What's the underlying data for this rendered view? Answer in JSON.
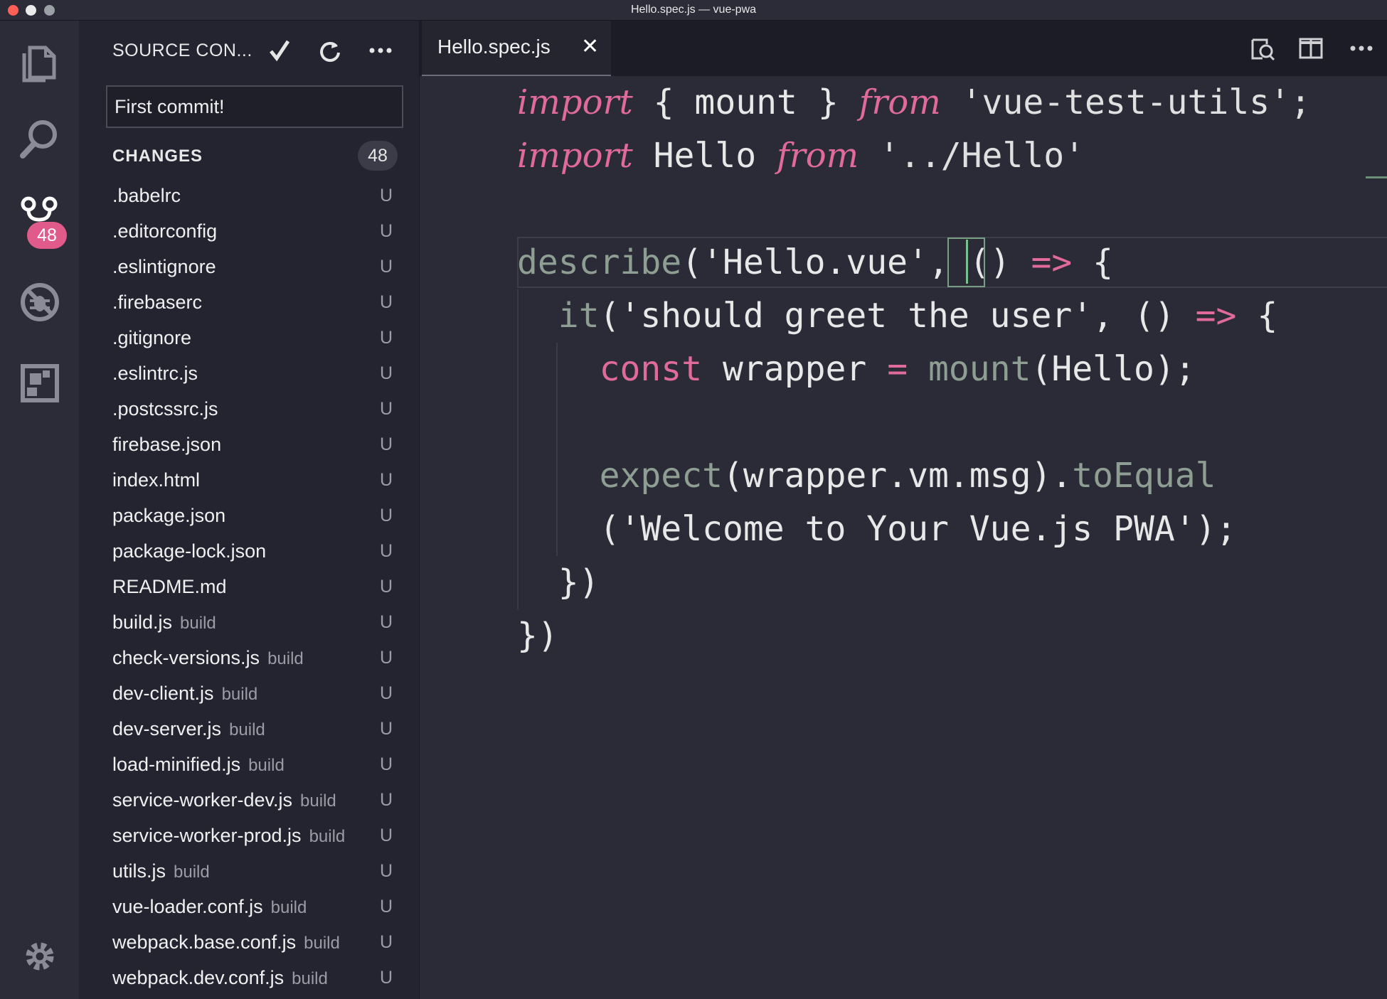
{
  "window": {
    "title": "Hello.spec.js — vue-pwa"
  },
  "activity_bar": {
    "items": [
      {
        "name": "files-icon"
      },
      {
        "name": "search-icon"
      },
      {
        "name": "source-control-icon",
        "badge": "48"
      },
      {
        "name": "debug-icon"
      },
      {
        "name": "extensions-icon"
      }
    ],
    "settings": "gear-icon"
  },
  "sidebar": {
    "header": "SOURCE CON...",
    "actions": [
      "commit-check-icon",
      "refresh-icon",
      "more-icon"
    ],
    "commit_message": "First commit!",
    "changes_label": "CHANGES",
    "changes_count": "48",
    "files": [
      {
        "name": ".babelrc",
        "dir": "",
        "status": "U"
      },
      {
        "name": ".editorconfig",
        "dir": "",
        "status": "U"
      },
      {
        "name": ".eslintignore",
        "dir": "",
        "status": "U"
      },
      {
        "name": ".firebaserc",
        "dir": "",
        "status": "U"
      },
      {
        "name": ".gitignore",
        "dir": "",
        "status": "U"
      },
      {
        "name": ".eslintrc.js",
        "dir": "",
        "status": "U"
      },
      {
        "name": ".postcssrc.js",
        "dir": "",
        "status": "U"
      },
      {
        "name": "firebase.json",
        "dir": "",
        "status": "U"
      },
      {
        "name": "index.html",
        "dir": "",
        "status": "U"
      },
      {
        "name": "package.json",
        "dir": "",
        "status": "U"
      },
      {
        "name": "package-lock.json",
        "dir": "",
        "status": "U"
      },
      {
        "name": "README.md",
        "dir": "",
        "status": "U"
      },
      {
        "name": "build.js",
        "dir": "build",
        "status": "U"
      },
      {
        "name": "check-versions.js",
        "dir": "build",
        "status": "U"
      },
      {
        "name": "dev-client.js",
        "dir": "build",
        "status": "U"
      },
      {
        "name": "dev-server.js",
        "dir": "build",
        "status": "U"
      },
      {
        "name": "load-minified.js",
        "dir": "build",
        "status": "U"
      },
      {
        "name": "service-worker-dev.js",
        "dir": "build",
        "status": "U"
      },
      {
        "name": "service-worker-prod.js",
        "dir": "build",
        "status": "U"
      },
      {
        "name": "utils.js",
        "dir": "build",
        "status": "U"
      },
      {
        "name": "vue-loader.conf.js",
        "dir": "build",
        "status": "U"
      },
      {
        "name": "webpack.base.conf.js",
        "dir": "build",
        "status": "U"
      },
      {
        "name": "webpack.dev.conf.js",
        "dir": "build",
        "status": "U"
      }
    ]
  },
  "editor": {
    "tab": {
      "label": "Hello.spec.js",
      "close": "✕"
    },
    "actions": [
      "open-preview-icon",
      "split-editor-icon",
      "more-icon"
    ],
    "code": {
      "l1_kw": "import",
      "l1_a": " { mount } ",
      "l1_from": "from",
      "l1_b": " 'vue-test-utils';",
      "l2_kw": "import",
      "l2_a": " Hello ",
      "l2_from": "from",
      "l2_b": " '../Hello'",
      "l4_fn": "describe",
      "l4_a": "('Hello.vue', () ",
      "l4_arrow": "=>",
      "l4_b": " {",
      "l5_fn": "  it",
      "l5_a": "('should greet the user', () ",
      "l5_arrow": "=>",
      "l5_b": " {",
      "l6_kw": "    const",
      "l6_a": " wrapper ",
      "l6_eq": "=",
      "l6_fn": " mount",
      "l6_b": "(Hello);",
      "l8_fn": "    expect",
      "l8_a": "(wrapper.vm.msg).",
      "l8_fn2": "toEqual",
      "l9": "    ('Welcome to Your Vue.js PWA');",
      "l10": "  })",
      "l11": "})"
    }
  }
}
